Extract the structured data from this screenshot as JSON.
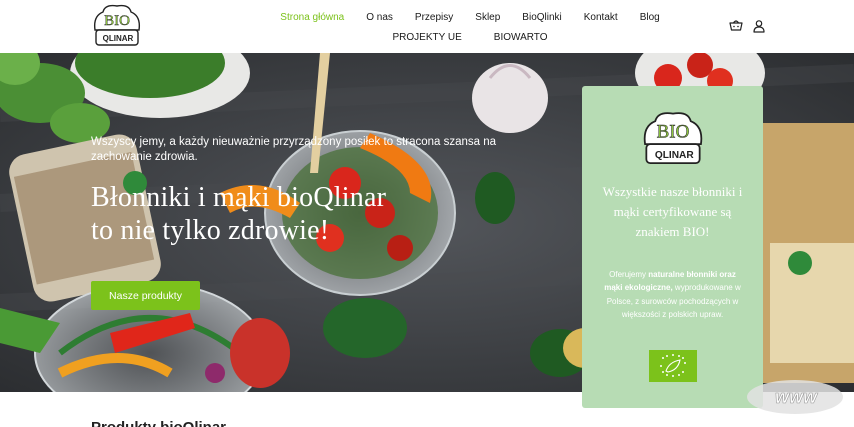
{
  "header": {
    "logo_text_top": "BIO",
    "logo_text_bottom": "QLINAR",
    "nav_row1": [
      {
        "label": "Strona główna",
        "active": true
      },
      {
        "label": "O nas",
        "active": false
      },
      {
        "label": "Przepisy",
        "active": false
      },
      {
        "label": "Sklep",
        "active": false
      },
      {
        "label": "BioQlinki",
        "active": false
      },
      {
        "label": "Kontakt",
        "active": false
      },
      {
        "label": "Blog",
        "active": false
      }
    ],
    "nav_row2": [
      {
        "label": "PROJEKTY UE"
      },
      {
        "label": "BIOWARTO"
      }
    ],
    "icons": [
      "cart-icon",
      "user-icon"
    ]
  },
  "hero": {
    "subtitle": "Wszyscy jemy, a każdy nieuważnie przyrządzony posiłek to stracona szansa na zachowanie zdrowia.",
    "title_line1": "Błonniki i mąki bioQlinar",
    "title_line2": "to nie tylko zdrowie!",
    "button_label": "Nasze produkty"
  },
  "card": {
    "logo_text_top": "BIO",
    "logo_text_bottom": "QLINAR",
    "heading": "Wszystkie nasze błonniki i mąki certyfikowane są znakiem BIO!",
    "body_pre": "Oferujemy ",
    "body_bold": "naturalne błonniki oraz mąki ekologiczne,",
    "body_post": " wyprodukowane w Polsce, z surowców pochodzących w większości z polskich upraw."
  },
  "below": {
    "section_title": "Produkty bioQlinar"
  },
  "watermark": {
    "text": "www"
  },
  "colors": {
    "accent": "#7cc21b",
    "card_bg": "#b7dcb4",
    "hero_bg": "#3f4146"
  }
}
